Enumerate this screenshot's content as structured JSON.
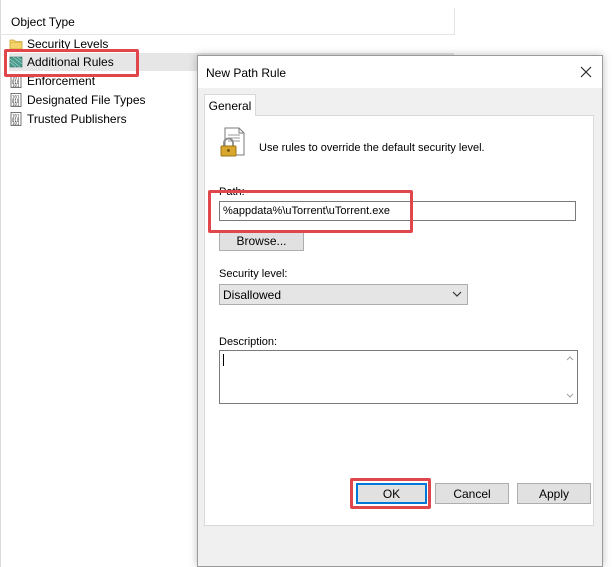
{
  "tree": {
    "column_header": "Object Type",
    "items": [
      {
        "label": "Security Levels",
        "icon": "folder-icon"
      },
      {
        "label": "Additional Rules",
        "icon": "rules-icon",
        "selected": true
      },
      {
        "label": "Enforcement",
        "icon": "binary-doc-icon"
      },
      {
        "label": "Designated File Types",
        "icon": "binary-doc-icon"
      },
      {
        "label": "Trusted Publishers",
        "icon": "binary-doc-icon"
      }
    ]
  },
  "dialog": {
    "title": "New Path Rule",
    "close_glyph": "✕",
    "tab_label": "General",
    "intro_text": "Use rules to override the default security level.",
    "path_label": "Path:",
    "path_value": "%appdata%\\uTorrent\\uTorrent.exe",
    "browse_label": "Browse...",
    "security_label": "Security level:",
    "security_value": "Disallowed",
    "description_label": "Description:",
    "description_value": "",
    "ok_label": "OK",
    "cancel_label": "Cancel",
    "apply_label": "Apply"
  },
  "colors": {
    "highlight": "#e0474c",
    "dialog_bg": "#f0f0f0",
    "button_bg": "#e1e1e1",
    "default_button_border": "#0078d7",
    "selected_row": "#e6e6e6"
  }
}
